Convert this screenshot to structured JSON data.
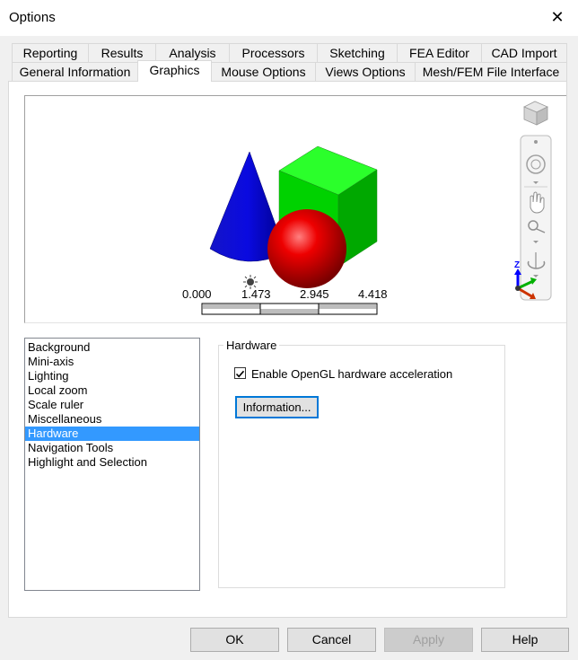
{
  "window": {
    "title": "Options",
    "close_glyph": "✕"
  },
  "tabs_row1": [
    {
      "label": "Reporting"
    },
    {
      "label": "Results"
    },
    {
      "label": "Analysis"
    },
    {
      "label": "Processors"
    },
    {
      "label": "Sketching"
    },
    {
      "label": "FEA Editor"
    },
    {
      "label": "CAD Import"
    }
  ],
  "tabs_row2": [
    {
      "label": "General Information"
    },
    {
      "label": "Graphics",
      "active": true
    },
    {
      "label": "Mouse Options"
    },
    {
      "label": "Views Options"
    },
    {
      "label": "Mesh/FEM File Interface"
    }
  ],
  "scale": {
    "ticks": [
      "0.000",
      "1.473",
      "2.945",
      "4.418"
    ]
  },
  "list": {
    "items": [
      "Background",
      "Mini-axis",
      "Lighting",
      "Local zoom",
      "Scale ruler",
      "Miscellaneous",
      "Hardware",
      "Navigation Tools",
      "Highlight and Selection"
    ],
    "selected_index": 6
  },
  "hardware": {
    "group_title": "Hardware",
    "opengl_label": "Enable OpenGL hardware acceleration",
    "opengl_checked": true,
    "info_button": "Information..."
  },
  "footer": {
    "ok": "OK",
    "cancel": "Cancel",
    "apply": "Apply",
    "help": "Help"
  },
  "colors": {
    "cone": "#0a0ad0",
    "cube": "#00cc00",
    "sphere": "#e00000",
    "selection": "#3399ff"
  }
}
